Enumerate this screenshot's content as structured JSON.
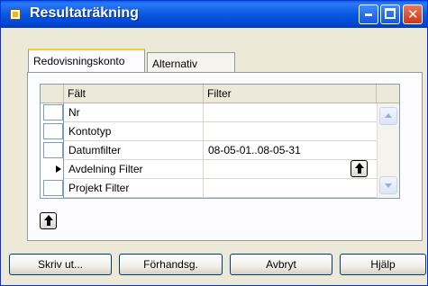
{
  "window": {
    "title": "Resultaträkning"
  },
  "tabs": [
    {
      "label": "Redovisningskonto",
      "active": true
    },
    {
      "label": "Alternativ",
      "active": false
    }
  ],
  "grid": {
    "columns": [
      "Fält",
      "Filter"
    ],
    "rows": [
      {
        "falt": "Nr",
        "filter": "",
        "current": false
      },
      {
        "falt": "Kontotyp",
        "filter": "",
        "current": false
      },
      {
        "falt": "Datumfilter",
        "filter": "08-05-01..08-05-31",
        "current": false
      },
      {
        "falt": "Avdelning Filter",
        "filter": "",
        "current": true
      },
      {
        "falt": "Projekt Filter",
        "filter": "",
        "current": false
      }
    ]
  },
  "buttons": {
    "print": "Skriv ut...",
    "preview": "Förhandsg.",
    "cancel": "Avbryt",
    "help": "Hjälp"
  },
  "icons": {
    "title": "report-icon",
    "lookup": "arrow-up-icon"
  }
}
